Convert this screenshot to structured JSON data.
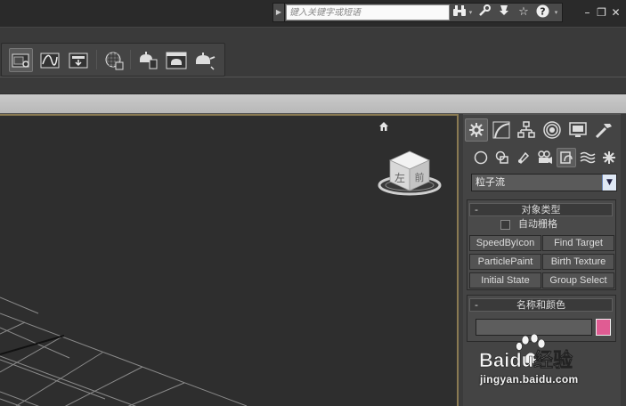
{
  "titlebar": {
    "search_placeholder": "键入关键字或短语",
    "search_arrow": "▶",
    "icons": [
      "binoculars-icon",
      "wrench-icon",
      "pin-icon",
      "star-icon",
      "help-icon"
    ],
    "window_controls": [
      "minimize",
      "restore",
      "close"
    ]
  },
  "toolbar": {
    "buttons": [
      "open-explorer",
      "curve-editor",
      "schematic-view",
      "material-editor",
      "render-setup",
      "rendered-frame-window",
      "render-production"
    ]
  },
  "command_panel": {
    "tabs": [
      "create",
      "modify",
      "hierarchy",
      "motion",
      "display",
      "utilities"
    ],
    "active_tab": "create",
    "subcategories": [
      "geometry",
      "shapes",
      "lights",
      "cameras",
      "helpers",
      "space-warps",
      "systems"
    ],
    "active_subcategory": "helpers",
    "category_selected": "粒子流",
    "object_type": {
      "title": "对象类型",
      "collapse_symbol": "-",
      "autogrid_label": "自动栅格",
      "autogrid_checked": false,
      "buttons": [
        "SpeedByIcon",
        "Find Target",
        "ParticlePaint",
        "Birth Texture",
        "Initial State",
        "Group Select"
      ]
    },
    "name_color": {
      "title": "名称和颜色",
      "collapse_symbol": "-",
      "name_value": "",
      "color": "#e05c93"
    }
  },
  "viewport": {
    "viewcube_front_label": "前",
    "viewcube_left_label": "左",
    "border_color": "#8a7a52"
  },
  "watermark": {
    "brand_text": "Baidu经验",
    "url": "jingyan.baidu.com"
  }
}
